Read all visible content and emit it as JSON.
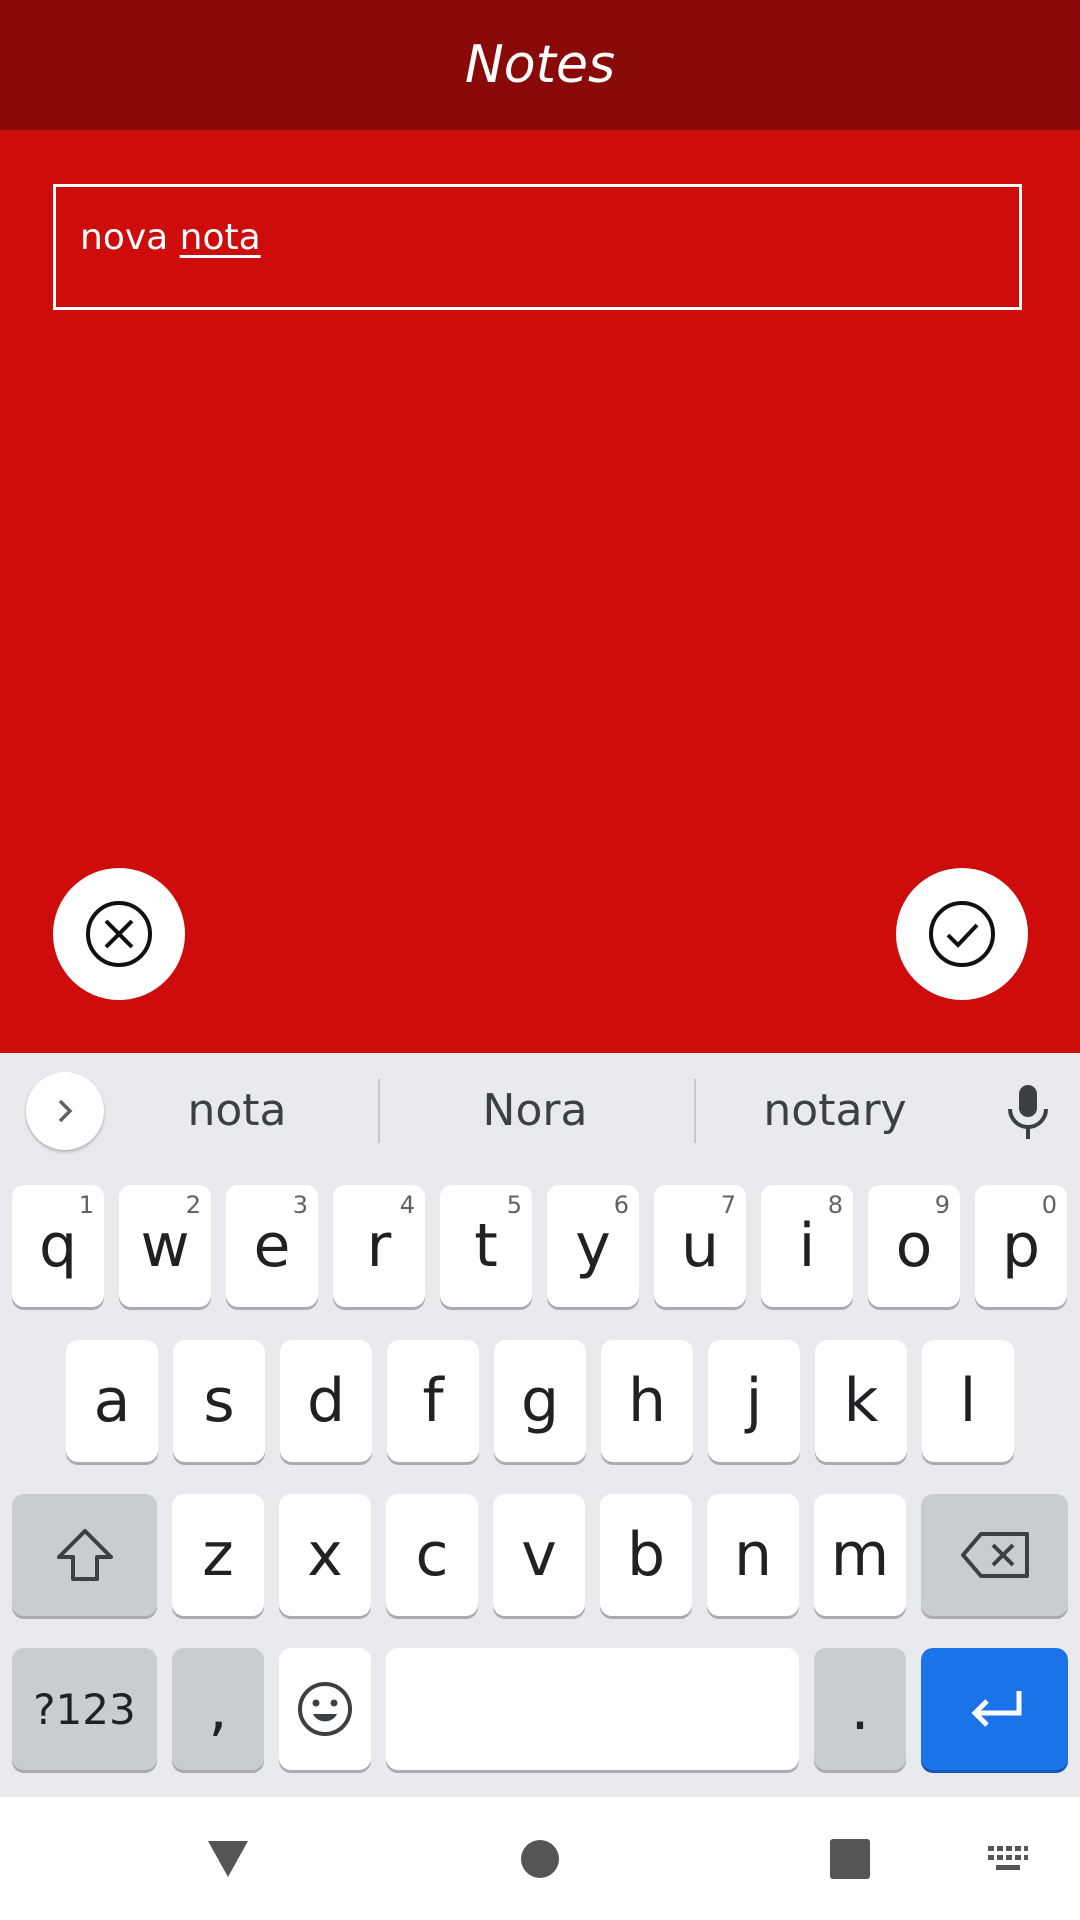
{
  "app": {
    "title": "Notes"
  },
  "note": {
    "prefix": "nova ",
    "composing": "nota"
  },
  "colors": {
    "appbar": "#8a0a0a",
    "background": "#ce0c0c",
    "enter_key": "#1a73e8"
  },
  "actions": {
    "cancel_icon": "close-circle-icon",
    "confirm_icon": "check-circle-icon"
  },
  "keyboard": {
    "suggestions": [
      "nota",
      "Nora",
      "notary"
    ],
    "row1": [
      {
        "k": "q",
        "h": "1"
      },
      {
        "k": "w",
        "h": "2"
      },
      {
        "k": "e",
        "h": "3"
      },
      {
        "k": "r",
        "h": "4"
      },
      {
        "k": "t",
        "h": "5"
      },
      {
        "k": "y",
        "h": "6"
      },
      {
        "k": "u",
        "h": "7"
      },
      {
        "k": "i",
        "h": "8"
      },
      {
        "k": "o",
        "h": "9"
      },
      {
        "k": "p",
        "h": "0"
      }
    ],
    "row2": [
      "a",
      "s",
      "d",
      "f",
      "g",
      "h",
      "j",
      "k",
      "l"
    ],
    "row3": [
      "z",
      "x",
      "c",
      "v",
      "b",
      "n",
      "m"
    ],
    "symbols_label": "?123",
    "comma": ",",
    "period": "."
  }
}
